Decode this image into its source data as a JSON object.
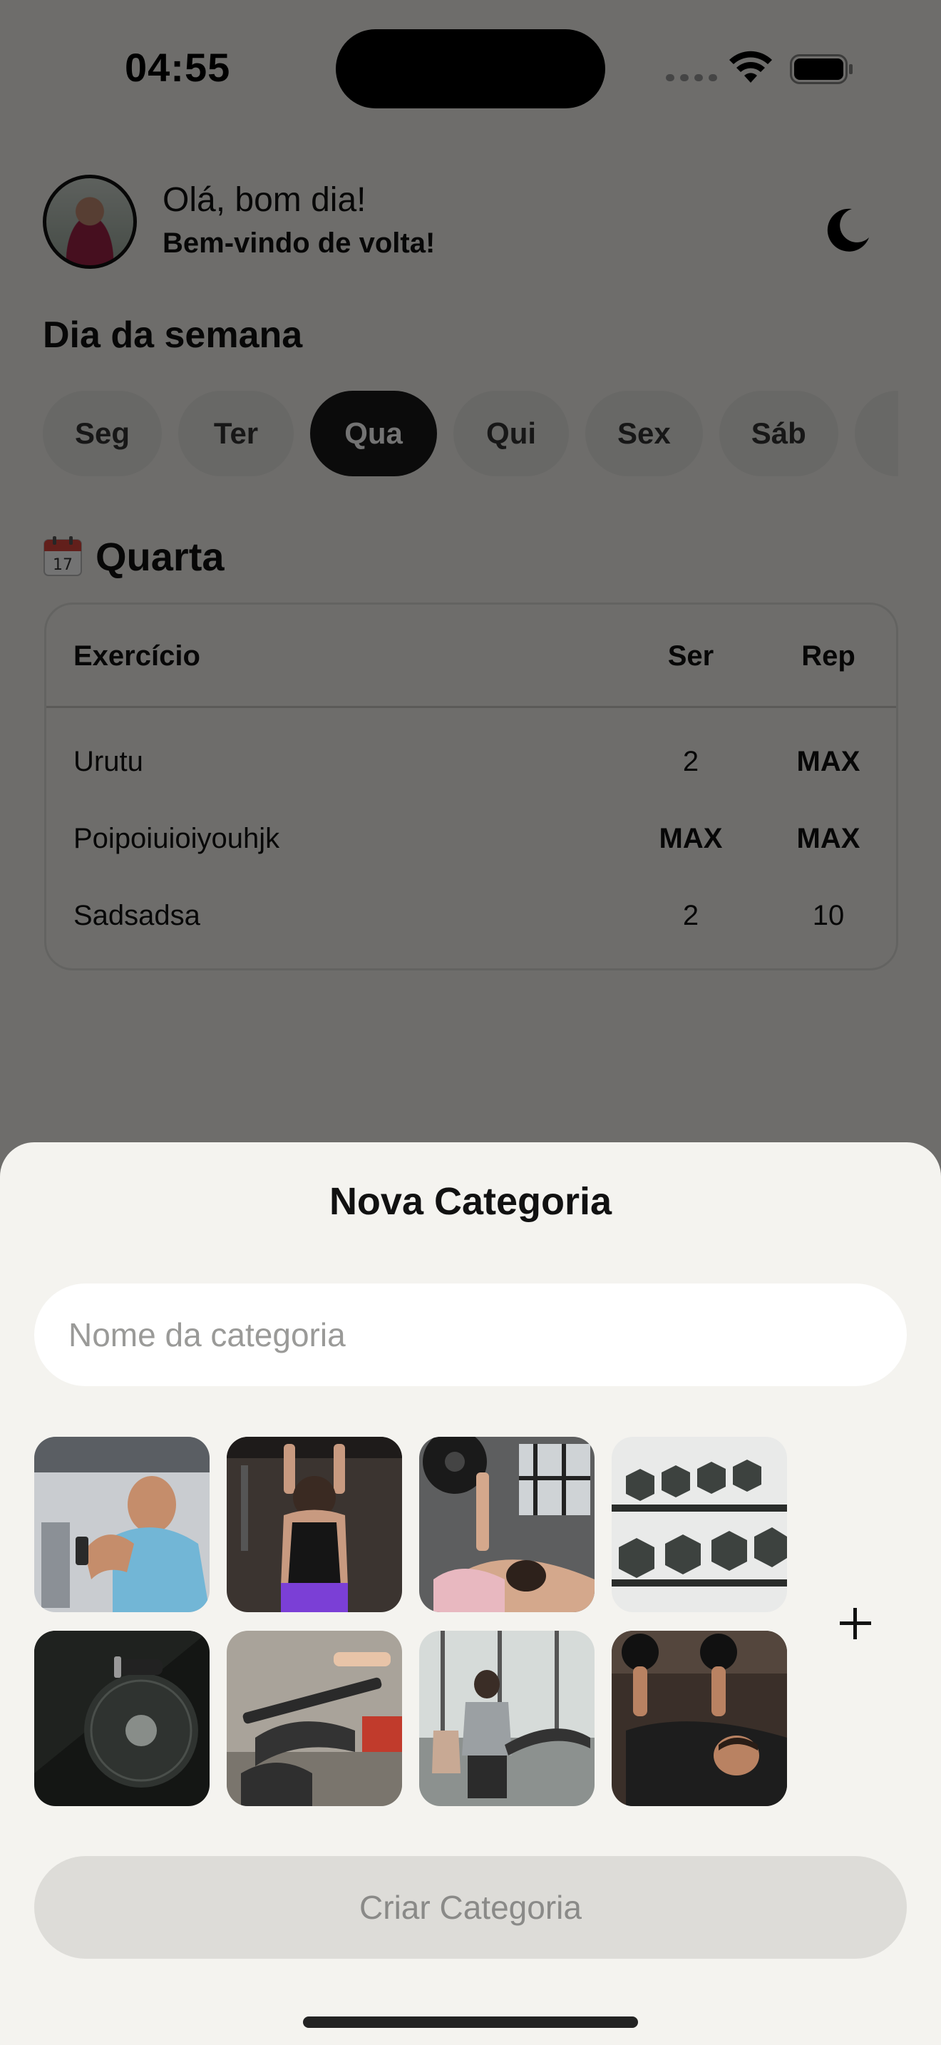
{
  "status_bar": {
    "time": "04:55"
  },
  "header": {
    "greeting": "Olá, bom dia!",
    "welcome": "Bem-vindo de volta!"
  },
  "week": {
    "title": "Dia da semana",
    "days": [
      {
        "label": "Seg",
        "active": false
      },
      {
        "label": "Ter",
        "active": false
      },
      {
        "label": "Qua",
        "active": true
      },
      {
        "label": "Qui",
        "active": false
      },
      {
        "label": "Sex",
        "active": false
      },
      {
        "label": "Sáb",
        "active": false
      }
    ]
  },
  "workout": {
    "day_name": "Quarta",
    "columns": [
      "Exercício",
      "Ser",
      "Rep"
    ],
    "rows": [
      {
        "exercise": "Urutu",
        "sets": "2",
        "reps": "MAX"
      },
      {
        "exercise": "Poipoiuioiyouhjk",
        "sets": "MAX",
        "reps": "MAX"
      },
      {
        "exercise": "Sadsadsa",
        "sets": "2",
        "reps": "10"
      }
    ]
  },
  "sheet": {
    "title": "Nova Categoria",
    "name_placeholder": "Nome da categoria",
    "name_value": "",
    "images": [
      "cable-curl-man-photo",
      "pullup-woman-photo",
      "barbell-bench-woman-photo",
      "dumbbell-rack-photo",
      "weight-plate-photo",
      "leg-press-photo",
      "treadmill-gym-photo",
      "dumbbell-press-man-photo"
    ],
    "add_icon": "plus-icon",
    "create_label": "Criar Categoria"
  },
  "colors": {
    "overlay": "#000000",
    "sheet_bg": "#f4f3ef",
    "active_day": "#1a1a1a",
    "disabled_button": "#dddcd8"
  }
}
